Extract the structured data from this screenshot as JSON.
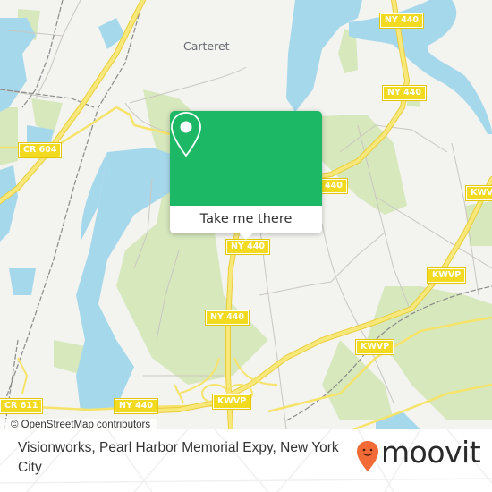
{
  "map": {
    "town_label": "Carteret",
    "route_shields": [
      {
        "label": "NY 440",
        "road": "NY 440"
      },
      {
        "label": "NY 440",
        "road": "NY 440"
      },
      {
        "label": "CR 604",
        "road": "CR 604"
      },
      {
        "label": "440",
        "road": "NY 440"
      },
      {
        "label": "NY 440",
        "road": "NY 440"
      },
      {
        "label": "KWVP",
        "road": "KWVP"
      },
      {
        "label": "KWVP",
        "road": "KWVP"
      },
      {
        "label": "NY 440",
        "road": "NY 440"
      },
      {
        "label": "KWVP",
        "road": "KWVP"
      },
      {
        "label": "KWVP",
        "road": "KWVP"
      },
      {
        "label": "CR 611",
        "road": "CR 611"
      },
      {
        "label": "NY 440",
        "road": "NY 440"
      }
    ],
    "attribution": "© OpenStreetMap contributors",
    "colors": {
      "land": "#f3f3ef",
      "water": "#a6d8ec",
      "park": "#d7e8bd",
      "highway": "#f6e36a",
      "shield": "#f2da21"
    }
  },
  "popup": {
    "icon": "map-pin-icon",
    "button_label": "Take me there",
    "color": "#1db866"
  },
  "footer": {
    "place_name": "Visionworks, Pearl Harbor Memorial Expy, New York City",
    "brand": "moovit",
    "brand_icon": "moovit-pin-icon",
    "brand_color": "#f26a35"
  }
}
